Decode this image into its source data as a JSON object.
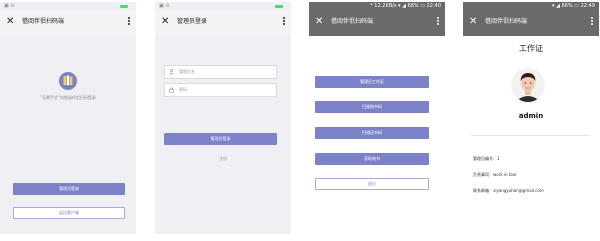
{
  "screen1": {
    "title": "借阅伴侣扫码端",
    "prompt": "\"无需手艺\"向借阅伴侣扫码登录",
    "primary_button": "管理员登录",
    "secondary_button": "返回客户端"
  },
  "screen2": {
    "title": "管理员登录",
    "username_placeholder": "管理员名",
    "password_placeholder": "密码",
    "login_button": "管理员登录",
    "register_link": "注册"
  },
  "screen3": {
    "status_text": "* 12.2KB/s ▾ ◢ 68% ▭ 22:40",
    "title": "借阅伴侣扫码端",
    "menu": [
      "管理员工作证",
      "扫描借书码",
      "扫描还书码",
      "获取借书"
    ],
    "logout_button": "退出"
  },
  "screen4": {
    "status_text": "▾ ◢ 66% ▭ 22:49",
    "title": "借阅伴侣扫码端",
    "card_title": "工作证",
    "admin_name": "admin",
    "info": [
      "管理员编号：1",
      "负责事项：work in tool",
      "联系邮箱：xiyangyuhan@gmail.com"
    ]
  },
  "colors": {
    "primary": "#7b82c7",
    "navbar_dark": "#6a6a6a",
    "navbar_light": "#f3f3f3",
    "page_gray": "#efeff4"
  }
}
